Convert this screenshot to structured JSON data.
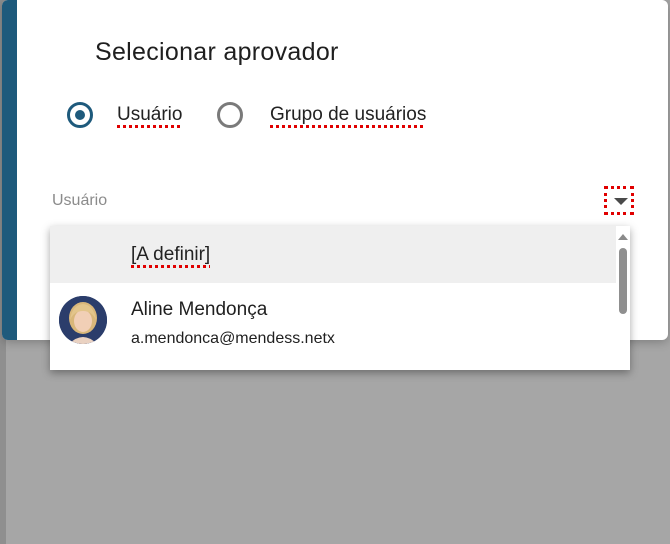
{
  "dialog": {
    "title": "Selecionar aprovador",
    "accent_color": "#1e5a7c"
  },
  "approver_type": {
    "options": [
      {
        "label": "Usuário",
        "selected": true
      },
      {
        "label": "Grupo de usuários",
        "selected": false
      }
    ]
  },
  "user_field": {
    "label": "Usuário",
    "toggle_icon": "caret-down-icon"
  },
  "dropdown": {
    "options": [
      {
        "label": "[A definir]"
      },
      {
        "name": "Aline Mendonça",
        "email": "a.mendonca@mendess.netx",
        "avatar_icon": "avatar-photo"
      }
    ],
    "scroll_icon": "scroll-up-icon"
  }
}
